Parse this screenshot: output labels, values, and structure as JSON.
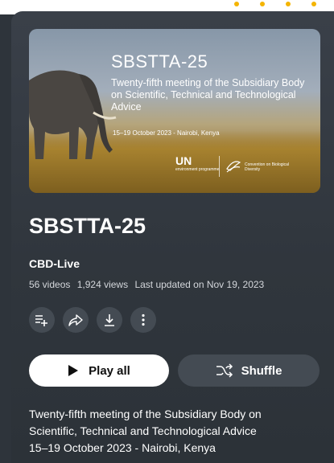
{
  "thumbnail": {
    "title": "SBSTTA-25",
    "subtitle": "Twenty-fifth meeting of the Subsidiary Body on Scientific, Technical and Technological Advice",
    "date_line": "15–19 October 2023 - Nairobi, Kenya",
    "logo_un": "UN",
    "logo_un_sub": "environment programme",
    "logo_cbd": "Convention on Biological Diversity"
  },
  "playlist": {
    "title": "SBSTTA-25",
    "channel": "CBD-Live",
    "video_count": "56 videos",
    "views": "1,924 views",
    "updated": "Last updated on Nov 19, 2023"
  },
  "actions": {
    "icons": [
      "add-to-queue-icon",
      "share-icon",
      "download-icon",
      "more-vert-icon"
    ],
    "play_all": "Play all",
    "shuffle": "Shuffle"
  },
  "description": {
    "line1": "Twenty-fifth meeting of the Subsidiary Body on",
    "line2": "Scientific, Technical and Technological Advice",
    "line3": "15–19 October 2023 - Nairobi, Kenya"
  },
  "colors": {
    "background": "#2e343b",
    "button_light": "#ffffff",
    "button_dark": "#444b53",
    "accent_dots": "#f4b400"
  }
}
